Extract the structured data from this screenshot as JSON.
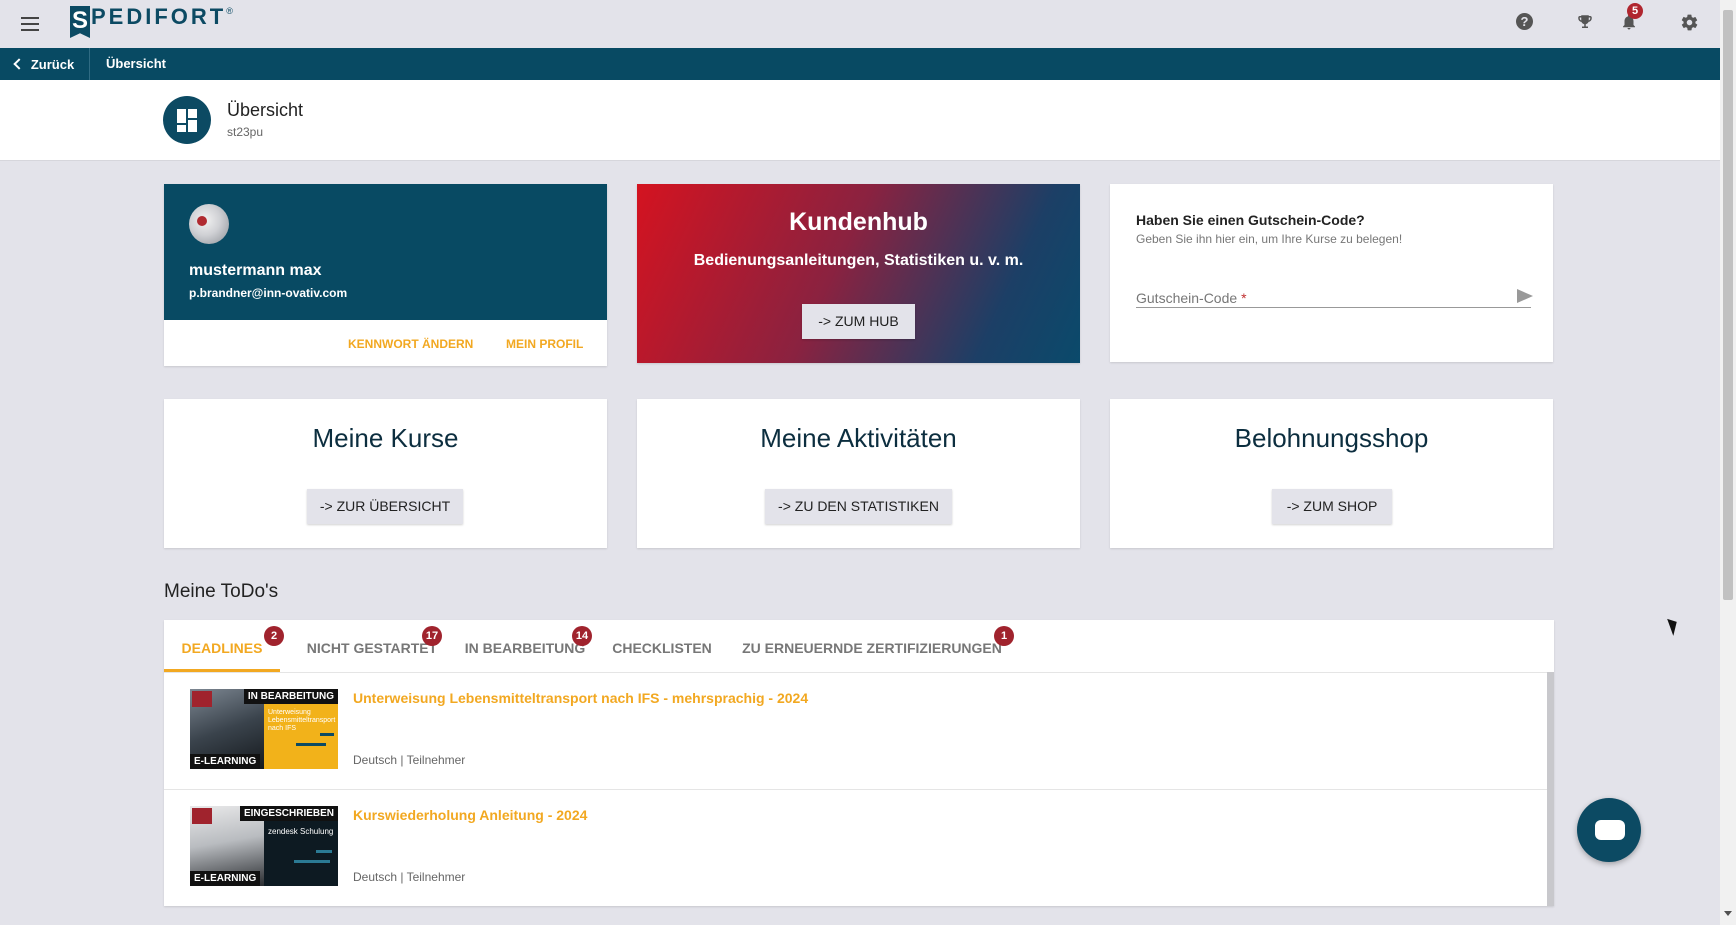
{
  "topbar": {
    "logo_letter": "S",
    "logo_text": "PEDIFORT",
    "logo_reg": "®",
    "icons": [
      "menu-icon",
      "help-icon",
      "trophy-icon",
      "bell-icon",
      "gear-icon"
    ],
    "notifications_count": "5"
  },
  "navbar": {
    "back_label": "Zurück",
    "breadcrumb": "Übersicht"
  },
  "header": {
    "title": "Übersicht",
    "subtitle": "st23pu"
  },
  "profile": {
    "name": "mustermann max",
    "email": "p.brandner@inn-ovativ.com",
    "change_password": "KENNWORT ÄNDERN",
    "my_profile": "MEIN PROFIL"
  },
  "hub": {
    "title": "Kundenhub",
    "subtitle": "Bedienungsanleitungen, Statistiken u. v. m.",
    "button": "-> ZUM HUB"
  },
  "voucher": {
    "title": "Haben Sie einen Gutschein-Code?",
    "subtitle": "Geben Sie ihn hier ein, um Ihre Kurse zu belegen!",
    "label": "Gutschein-Code",
    "required_mark": "*",
    "value": ""
  },
  "tiles": [
    {
      "title": "Meine Kurse",
      "button": "-> ZUR ÜBERSICHT"
    },
    {
      "title": "Meine Aktivitäten",
      "button": "-> ZU DEN STATISTIKEN"
    },
    {
      "title": "Belohnungsshop",
      "button": "-> ZUM SHOP"
    }
  ],
  "todos": {
    "heading": "Meine ToDo's",
    "tabs": [
      {
        "label": "DEADLINES",
        "badge": "2",
        "active": true
      },
      {
        "label": "NICHT GESTARTET",
        "badge": "17"
      },
      {
        "label": "IN BEARBEITUNG",
        "badge": "14"
      },
      {
        "label": "CHECKLISTEN",
        "badge": ""
      },
      {
        "label": "ZU ERNEUERNDE ZERTIFIZIERUNGEN",
        "badge": "1"
      }
    ],
    "items": [
      {
        "status": "IN BEARBEITUNG",
        "type": "E-LEARNING",
        "thumb_text": "Unterweisung Lebensmitteltransport nach IFS",
        "title": "Unterweisung Lebensmitteltransport nach IFS - mehrsprachig - 2024",
        "meta": "Deutsch | Teilnehmer"
      },
      {
        "status": "EINGESCHRIEBEN",
        "type": "E-LEARNING",
        "thumb_text": "zendesk Schulung",
        "title": "Kurswiederholung Anleitung - 2024",
        "meta": "Deutsch | Teilnehmer"
      }
    ]
  },
  "colors": {
    "brand_dark": "#084a63",
    "accent": "#f2a821",
    "badge": "#a0232d",
    "background": "#e3e3ea"
  }
}
